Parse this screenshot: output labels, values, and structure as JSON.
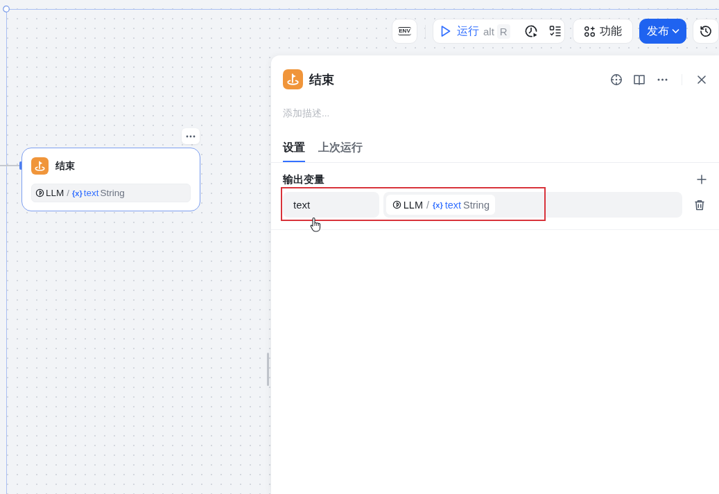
{
  "toolbar": {
    "env": "ENV",
    "run": {
      "label": "运行",
      "modifier": "alt",
      "key": "R"
    },
    "features": "功能",
    "publish": "发布"
  },
  "canvas": {
    "node": {
      "title": "结束",
      "output": {
        "source": "LLM",
        "separator": "/",
        "var_symbol": "{x}",
        "var_name": "text",
        "type": "String"
      }
    }
  },
  "panel": {
    "title": "结束",
    "description": {
      "placeholder": "添加描述..."
    },
    "tabs": [
      {
        "label": "设置",
        "selected": true
      },
      {
        "label": "上次运行",
        "selected": false
      }
    ],
    "section_title": "输出变量",
    "outputs": [
      {
        "name": "text",
        "source": "LLM",
        "separator": "/",
        "var_symbol": "{x}",
        "var_name": "text",
        "type": "String"
      }
    ]
  }
}
